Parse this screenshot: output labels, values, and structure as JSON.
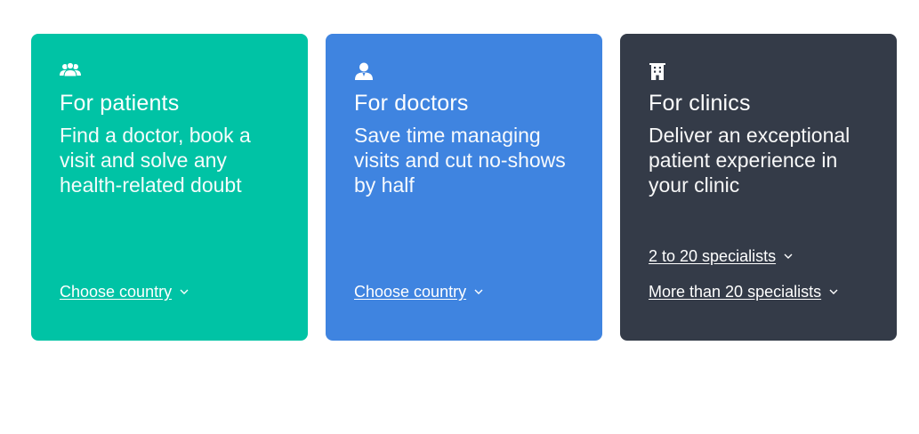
{
  "cards": [
    {
      "icon": "users-icon",
      "title": "For patients",
      "description": "Find a doctor, book a visit and solve any health-related doubt",
      "links": [
        {
          "label": "Choose country"
        }
      ],
      "color": "#00c3a5"
    },
    {
      "icon": "doctor-icon",
      "title": "For doctors",
      "description": "Save time managing visits and cut no-shows by half",
      "links": [
        {
          "label": "Choose country"
        }
      ],
      "color": "#3f84e0"
    },
    {
      "icon": "building-icon",
      "title": "For clinics",
      "description": "Deliver an exceptional patient experience in your clinic",
      "links": [
        {
          "label": "2 to 20 specialists"
        },
        {
          "label": "More than 20 specialists"
        }
      ],
      "color": "#343b48"
    }
  ]
}
